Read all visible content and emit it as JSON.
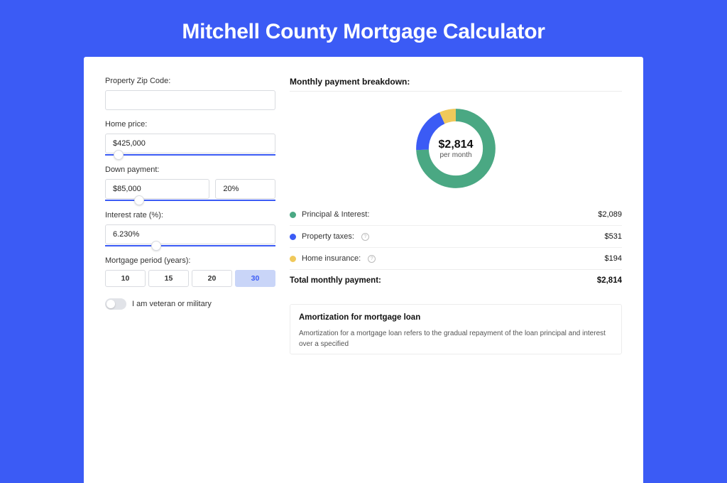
{
  "title": "Mitchell County Mortgage Calculator",
  "form": {
    "zip_label": "Property Zip Code:",
    "zip_value": "",
    "home_price_label": "Home price:",
    "home_price_value": "$425,000",
    "home_price_slider_pct": 8,
    "down_payment_label": "Down payment:",
    "down_payment_value": "$85,000",
    "down_payment_pct_value": "20%",
    "down_payment_slider_pct": 20,
    "interest_label": "Interest rate (%):",
    "interest_value": "6.230%",
    "interest_slider_pct": 30,
    "period_label": "Mortgage period (years):",
    "period_options": [
      "10",
      "15",
      "20",
      "30"
    ],
    "period_selected": "30",
    "veteran_label": "I am veteran or military",
    "veteran_on": false
  },
  "breakdown": {
    "heading": "Monthly payment breakdown:",
    "center_amount": "$2,814",
    "center_sub": "per month",
    "items": [
      {
        "label": "Principal & Interest:",
        "value": "$2,089",
        "color": "#4aa883",
        "info": false
      },
      {
        "label": "Property taxes:",
        "value": "$531",
        "color": "#3b5bf5",
        "info": true
      },
      {
        "label": "Home insurance:",
        "value": "$194",
        "color": "#f0c95b",
        "info": true
      }
    ],
    "total_label": "Total monthly payment:",
    "total_value": "$2,814"
  },
  "chart_data": {
    "type": "pie",
    "title": "Monthly payment breakdown",
    "series": [
      {
        "name": "Principal & Interest",
        "value": 2089,
        "color": "#4aa883"
      },
      {
        "name": "Property taxes",
        "value": 531,
        "color": "#3b5bf5"
      },
      {
        "name": "Home insurance",
        "value": 194,
        "color": "#f0c95b"
      }
    ],
    "total": 2814,
    "center_label": "$2,814 per month"
  },
  "amort": {
    "title": "Amortization for mortgage loan",
    "text": "Amortization for a mortgage loan refers to the gradual repayment of the loan principal and interest over a specified"
  }
}
